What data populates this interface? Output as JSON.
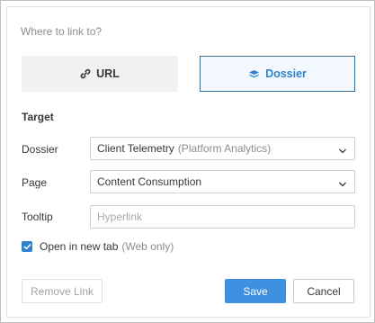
{
  "dialog": {
    "question": "Where to link to?",
    "link_types": {
      "url_label": "URL",
      "dossier_label": "Dossier",
      "selected": "Dossier"
    },
    "section_title": "Target",
    "dossier": {
      "label": "Dossier",
      "value": "Client Telemetry",
      "value_secondary": "(Platform Analytics)"
    },
    "page": {
      "label": "Page",
      "value": "Content Consumption"
    },
    "tooltip": {
      "label": "Tooltip",
      "value": "",
      "placeholder": "Hyperlink"
    },
    "open_new_tab": {
      "label": "Open in new tab",
      "hint": "(Web only)",
      "checked": true
    },
    "buttons": {
      "remove": "Remove Link",
      "save": "Save",
      "cancel": "Cancel"
    }
  },
  "colors": {
    "accent": "#2f83cf",
    "save_bg": "#3f90e0",
    "selected_border": "#3b6c92",
    "selected_bg": "#f2f8fd"
  },
  "icons": {
    "url": "link-icon",
    "dossier": "dossier-icon",
    "dropdown": "chevron-down-icon",
    "checkbox": "checkmark-icon"
  }
}
